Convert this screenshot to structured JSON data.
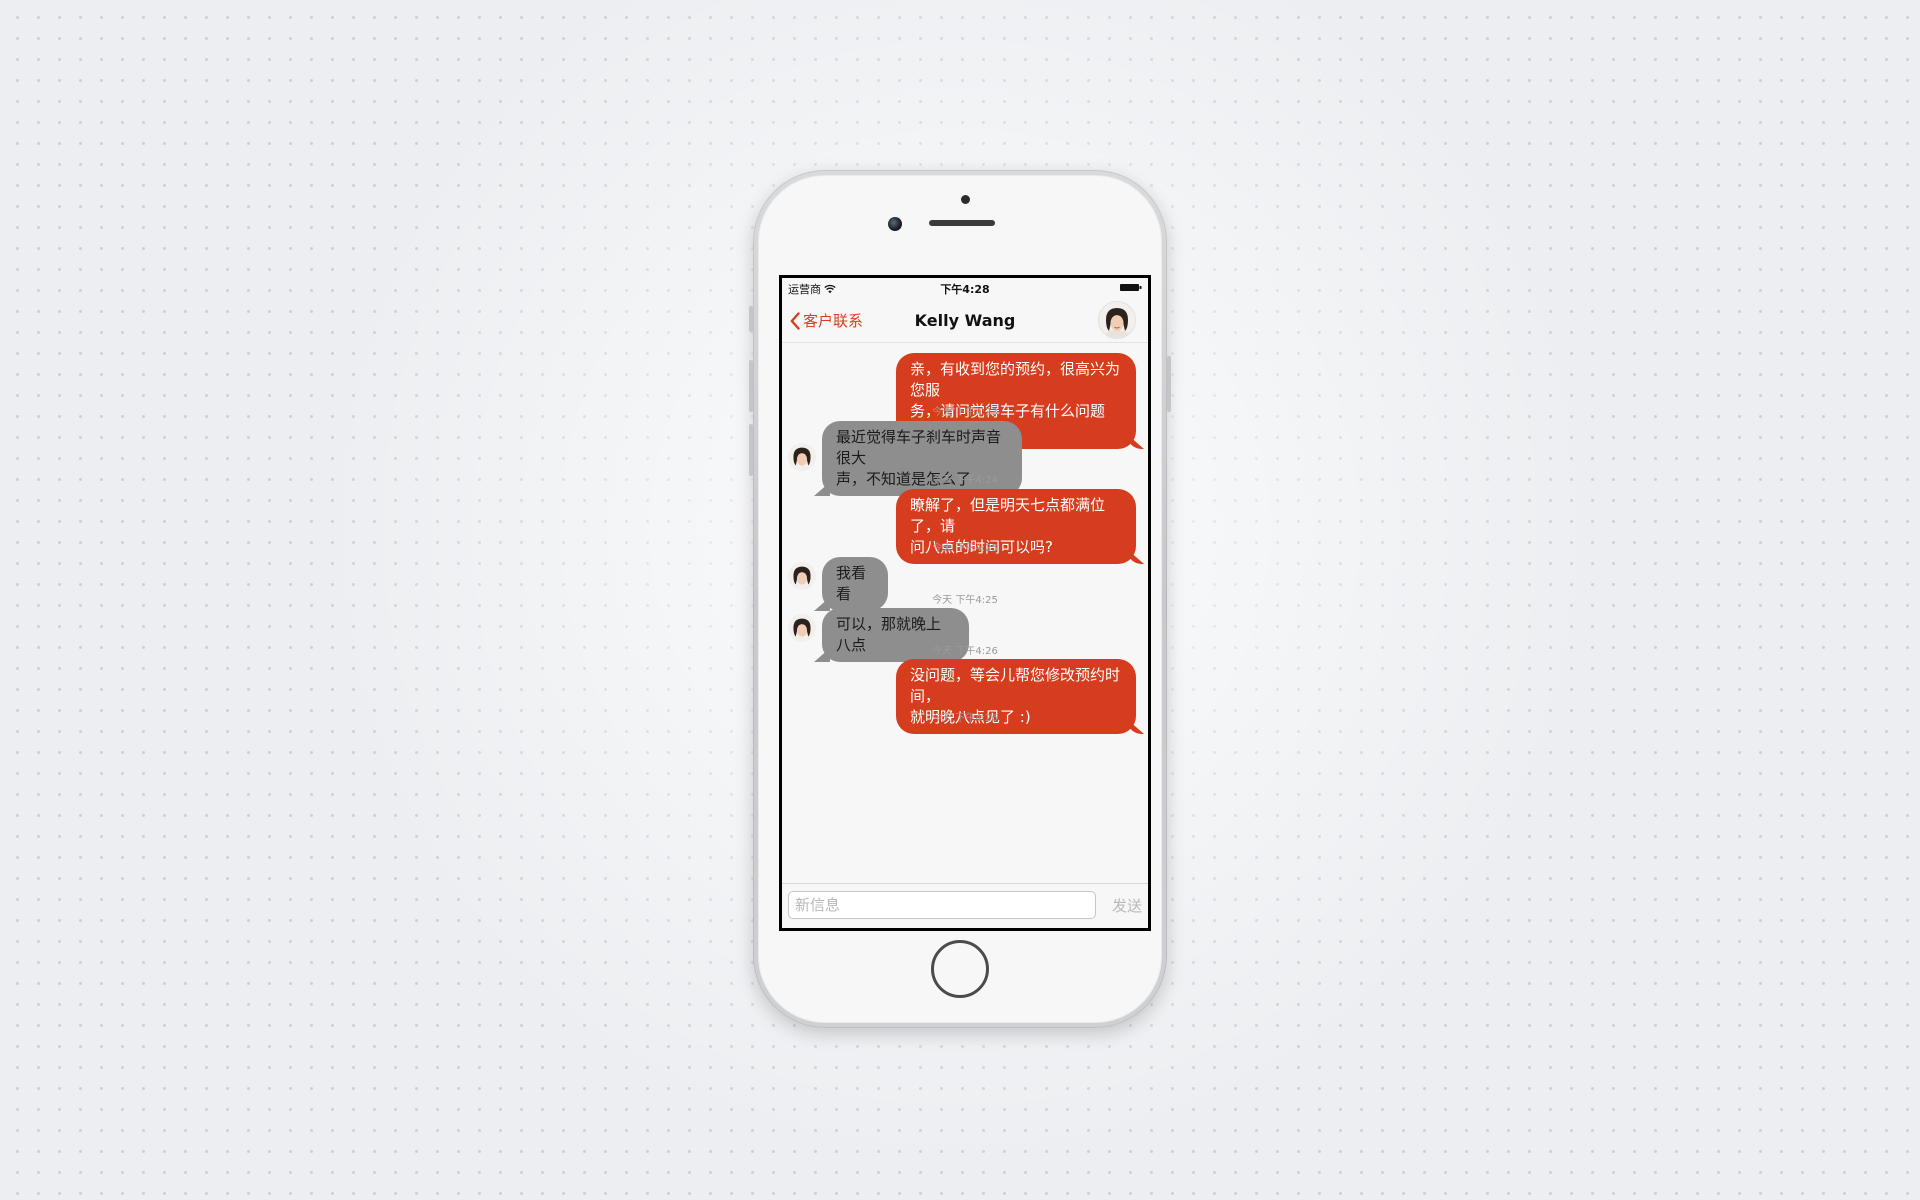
{
  "status_bar": {
    "carrier": "运营商",
    "time": "下午4:28"
  },
  "nav": {
    "back_label": "客户联系",
    "title": "Kelly Wang"
  },
  "messages": [
    {
      "direction": "outgoing",
      "text": "亲，有收到您的预约，很高兴为您服务，请问觉得车子有什么问题吗?",
      "lines": [
        "亲，有收到您的预约，很高兴为您服",
        "务，请问觉得车子有什么问题吗?"
      ],
      "timestamp": "今天 下午4:23"
    },
    {
      "direction": "incoming",
      "text": "最近觉得车子刹车时声音很大声，不知道是怎么了",
      "lines": [
        "最近觉得车子刹车时声音很大",
        "声，不知道是怎么了"
      ],
      "timestamp": "今天 下午4:24"
    },
    {
      "direction": "outgoing",
      "text": "瞭解了，但是明天七点都满位了，请问八点的时间可以吗?",
      "lines": [
        "瞭解了，但是明天七点都满位了，请",
        "问八点的时间可以吗?"
      ],
      "timestamp": "今天 下午4:25"
    },
    {
      "direction": "incoming",
      "text": "我看看",
      "lines": [
        "我看看"
      ],
      "timestamp": "今天 下午4:25"
    },
    {
      "direction": "incoming",
      "text": "可以，那就晚上八点",
      "lines": [
        "可以，那就晚上八点"
      ],
      "timestamp": "今天 下午4:26"
    },
    {
      "direction": "outgoing",
      "text": "没问题，等会儿帮您修改预约时间，就明晚八点见了 :)",
      "lines": [
        "没问题，等会儿帮您修改预约时间，",
        "就明晚八点见了 :)"
      ],
      "timestamp": "今天 下午4:26"
    }
  ],
  "input": {
    "placeholder": "新信息",
    "send_label": "发送"
  },
  "colors": {
    "accent": "#d63d1e",
    "incoming_bubble": "#8e8e8e",
    "timestamp": "#9a9a9a"
  },
  "icons": [
    "wifi-icon",
    "battery-icon",
    "chevron-left-icon",
    "avatar"
  ]
}
